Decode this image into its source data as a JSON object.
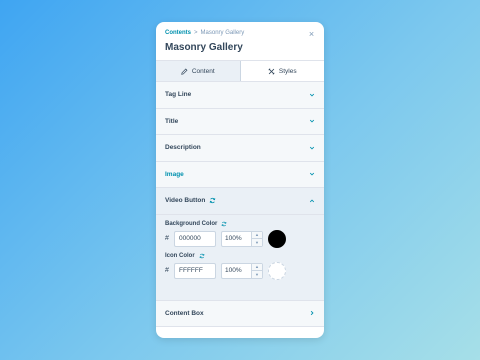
{
  "header": {
    "breadcrumb_parent": "Contents",
    "breadcrumb_sep": ">",
    "breadcrumb_current": "Masonry Gallery",
    "title": "Masonry Gallery",
    "close_icon": "×"
  },
  "tabs": [
    {
      "label": "Content",
      "icon": "pencil-icon",
      "active": false
    },
    {
      "label": "Styles",
      "icon": "styles-icon",
      "active": true
    }
  ],
  "sections": [
    {
      "label": "Tag Line"
    },
    {
      "label": "Title"
    },
    {
      "label": "Description"
    },
    {
      "label": "Image"
    },
    {
      "label": "Video Button"
    },
    {
      "label": "Content Box"
    }
  ],
  "video_button": {
    "background_color": {
      "label": "Background Color",
      "hash": "#",
      "hex": "000000",
      "opacity": "100%",
      "swatch": "#000000"
    },
    "icon_color": {
      "label": "Icon Color",
      "hash": "#",
      "hex": "FFFFFF",
      "opacity": "100%",
      "swatch": "#FFFFFF"
    }
  },
  "colors": {
    "accent": "#0091ae",
    "text": "#33475b",
    "muted": "#7c98b6"
  }
}
